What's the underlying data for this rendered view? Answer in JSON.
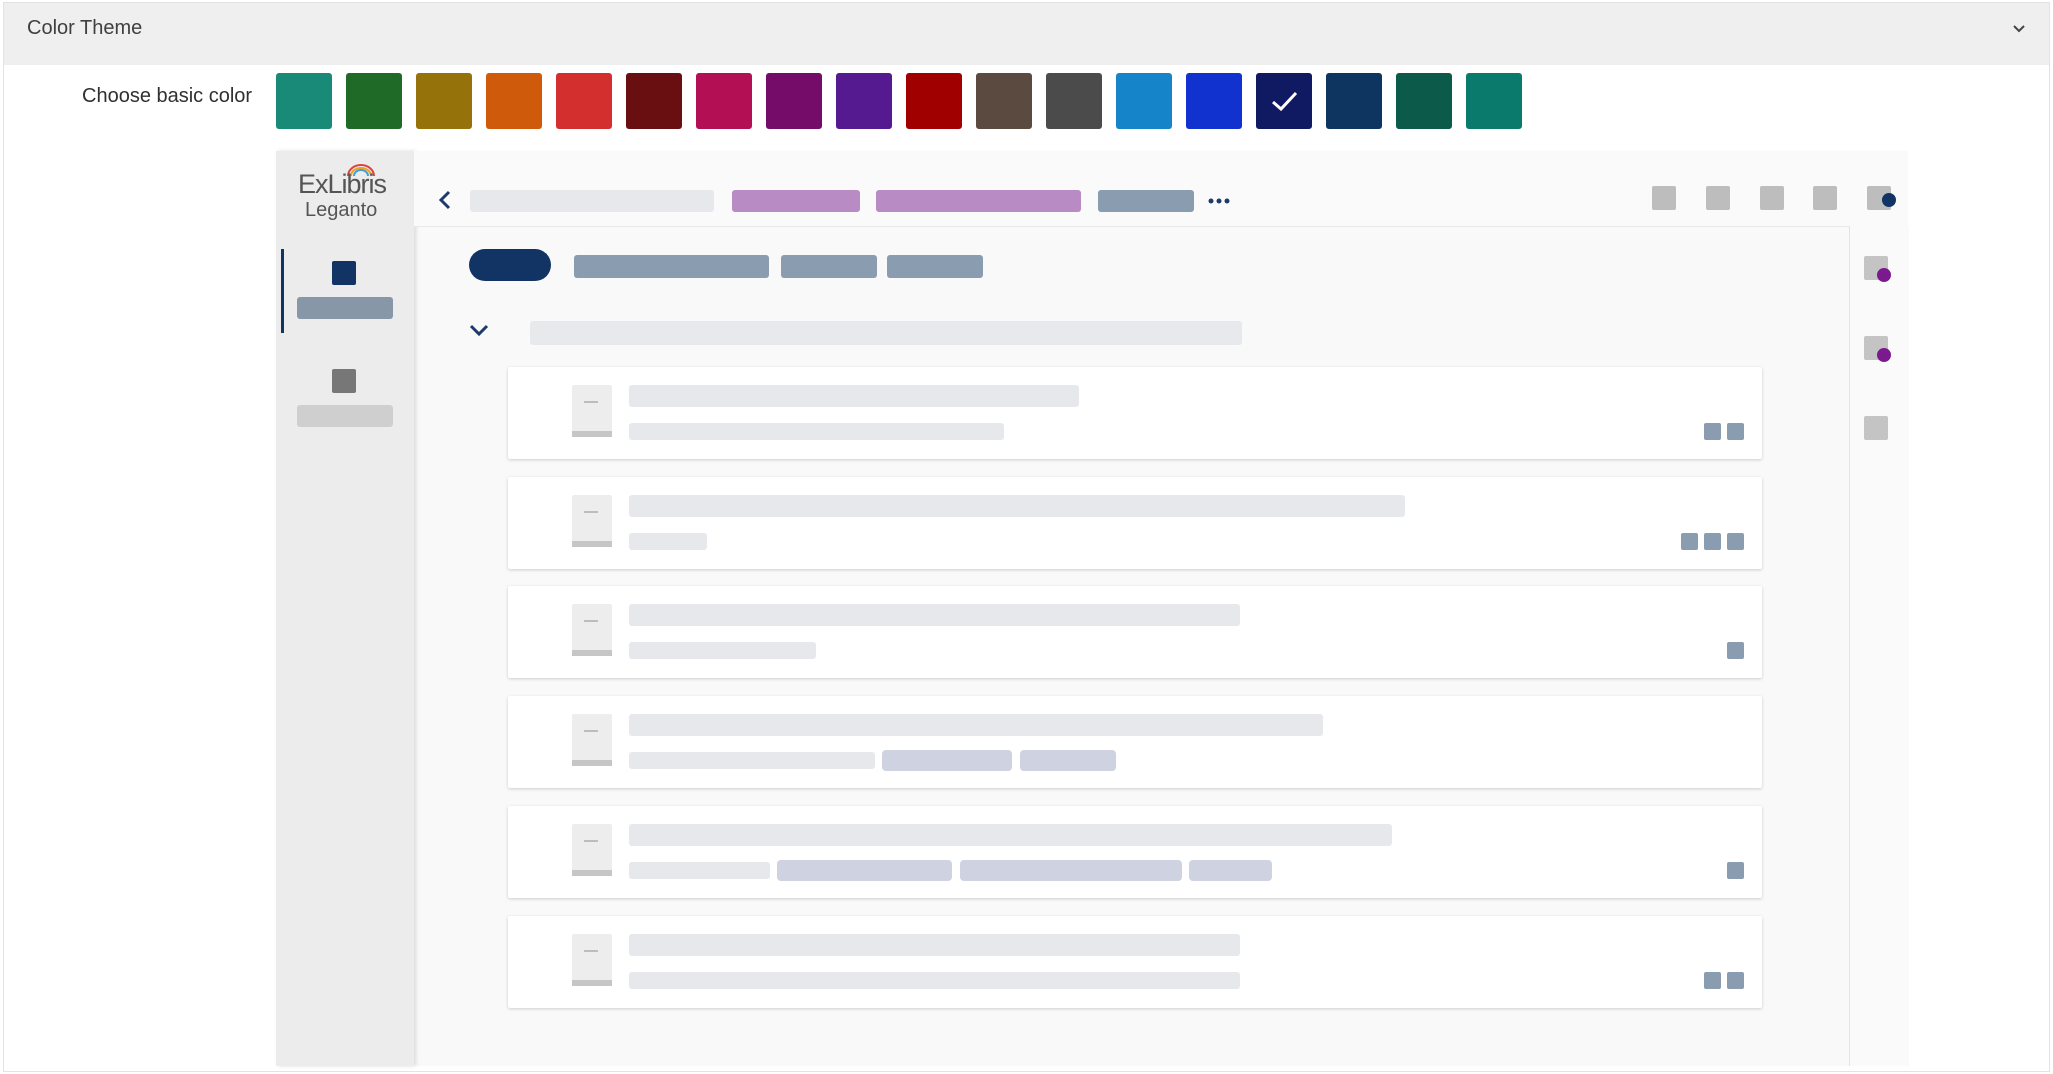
{
  "header": {
    "title": "Color Theme",
    "chevron_icon": "chevron-down-icon"
  },
  "theme": {
    "label": "Choose basic color",
    "selected_index": 14,
    "swatches": [
      "#1a8a78",
      "#1e6a26",
      "#96730a",
      "#d05a0c",
      "#d32f2f",
      "#6a0f11",
      "#b30f54",
      "#760c6a",
      "#551a8f",
      "#a00000",
      "#5a4a40",
      "#4b4b4b",
      "#1684c8",
      "#1232d0",
      "#101a63",
      "#0d3560",
      "#0c5a4a",
      "#0a7a6c"
    ]
  },
  "preview": {
    "logo_top": "ExLibris",
    "logo_bottom": "Leganto",
    "primary_color": "#123464",
    "accent_color": "#b98bc4",
    "badge_color": "#7b1a8c",
    "back_icon": "chevron-left-icon",
    "more_icon": "ellipsis-icon",
    "collapse_icon": "chevron-down-icon"
  }
}
